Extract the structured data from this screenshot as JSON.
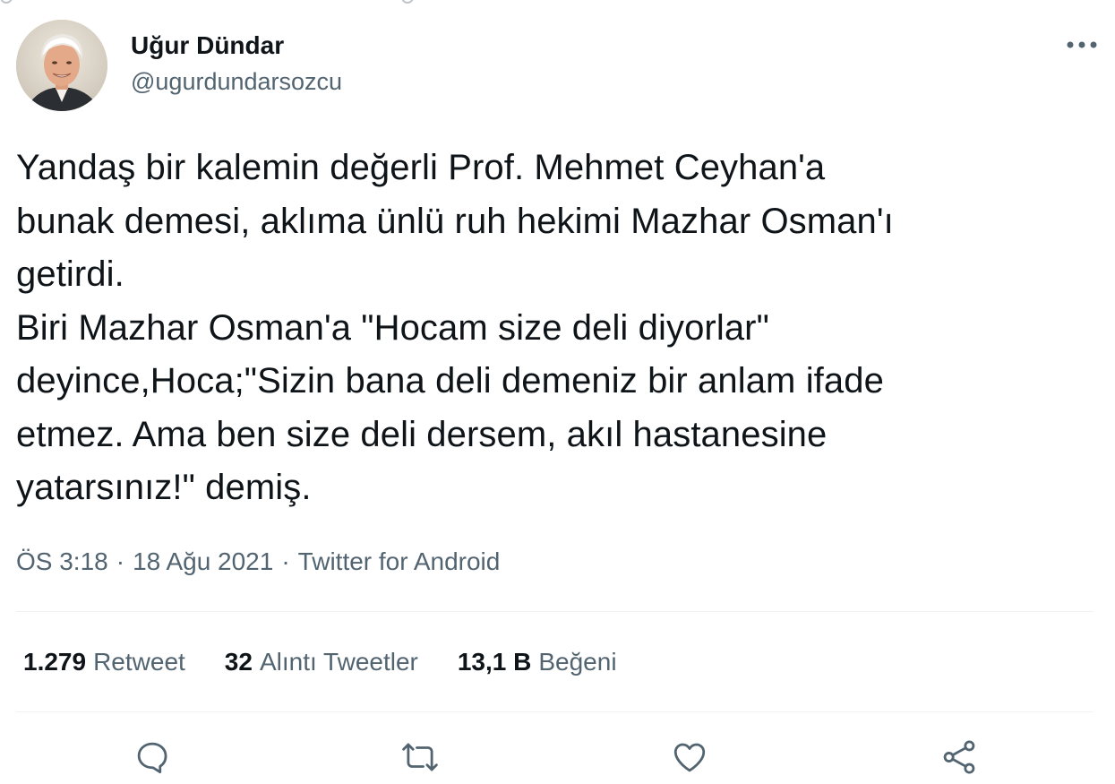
{
  "tweet": {
    "author": {
      "display_name": "Uğur Dündar",
      "handle": "@ugurdundarsozcu"
    },
    "text": "Yandaş bir kalemin değerli Prof. Mehmet Ceyhan'a\nbunak demesi, aklıma ünlü ruh hekimi Mazhar Osman'ı\ngetirdi.\nBiri Mazhar Osman'a \"Hocam size deli diyorlar\"\ndeyince,Hoca;\"Sizin bana deli demeniz bir anlam ifade\netmez. Ama ben size deli dersem, akıl hastanesine\nyatarsınız!\" demiş.",
    "meta": {
      "time": "ÖS 3:18",
      "separator": "·",
      "date": "18 Ağu 2021",
      "source": "Twitter for Android"
    },
    "stats": {
      "retweets": {
        "count": "1.279",
        "label": "Retweet"
      },
      "quotes": {
        "count": "32",
        "label": "Alıntı Tweetler"
      },
      "likes": {
        "count": "13,1 B",
        "label": "Beğeni"
      }
    },
    "actions": [
      {
        "icon": "reply-icon"
      },
      {
        "icon": "retweet-icon"
      },
      {
        "icon": "like-icon"
      },
      {
        "icon": "share-icon"
      }
    ],
    "more_icon": "more-icon"
  },
  "colors": {
    "text_primary": "#0f1419",
    "text_secondary": "#536471",
    "divider": "#eff3f4",
    "icon": "#536471"
  }
}
